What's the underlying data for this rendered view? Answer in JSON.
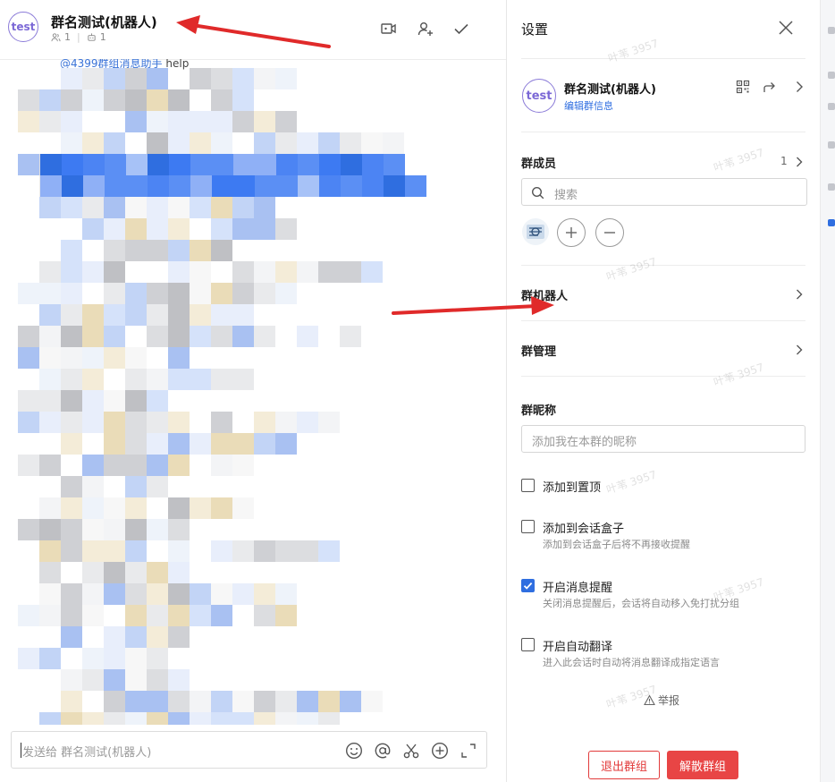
{
  "chat": {
    "avatar_text": "test",
    "title": "群名测试(机器人)",
    "member_count": "1",
    "bot_count": "1",
    "visible_snippet_mention": "@4399群组消息助手",
    "visible_snippet_rest": "help",
    "composer_placeholder": "发送给 群名测试(机器人)"
  },
  "header_icons": [
    "video-call-icon",
    "add-member-icon",
    "check-icon"
  ],
  "composer_icons": [
    "emoji-icon",
    "mention-icon",
    "scissors-icon",
    "plus-circle-icon",
    "expand-icon"
  ],
  "settings": {
    "title": "设置",
    "group_card": {
      "avatar_text": "test",
      "name": "群名测试(机器人)",
      "edit_link": "编辑群信息"
    },
    "members": {
      "label": "群成员",
      "count": "1",
      "search_placeholder": "搜索"
    },
    "robots_label": "群机器人",
    "manage_label": "群管理",
    "nickname": {
      "label": "群昵称",
      "placeholder": "添加我在本群的昵称"
    },
    "options": [
      {
        "label": "添加到置顶",
        "desc": "",
        "checked": false
      },
      {
        "label": "添加到会话盒子",
        "desc": "添加到会话盒子后将不再接收提醒",
        "checked": false
      },
      {
        "label": "开启消息提醒",
        "desc": "关闭消息提醒后，会话将自动移入免打扰分组",
        "checked": true
      },
      {
        "label": "开启自动翻译",
        "desc": "进入此会话时自动将消息翻译成指定语言",
        "checked": false
      }
    ],
    "report_label": "举报",
    "exit_button": "退出群组",
    "dismiss_button": "解散群组"
  },
  "watermark_text": "叶苇 3957",
  "colors": {
    "accent": "#2f6ee0",
    "avatar_ring": "#8b7bd8",
    "danger": "#e84545",
    "annotation_arrow": "#e02a2a"
  }
}
